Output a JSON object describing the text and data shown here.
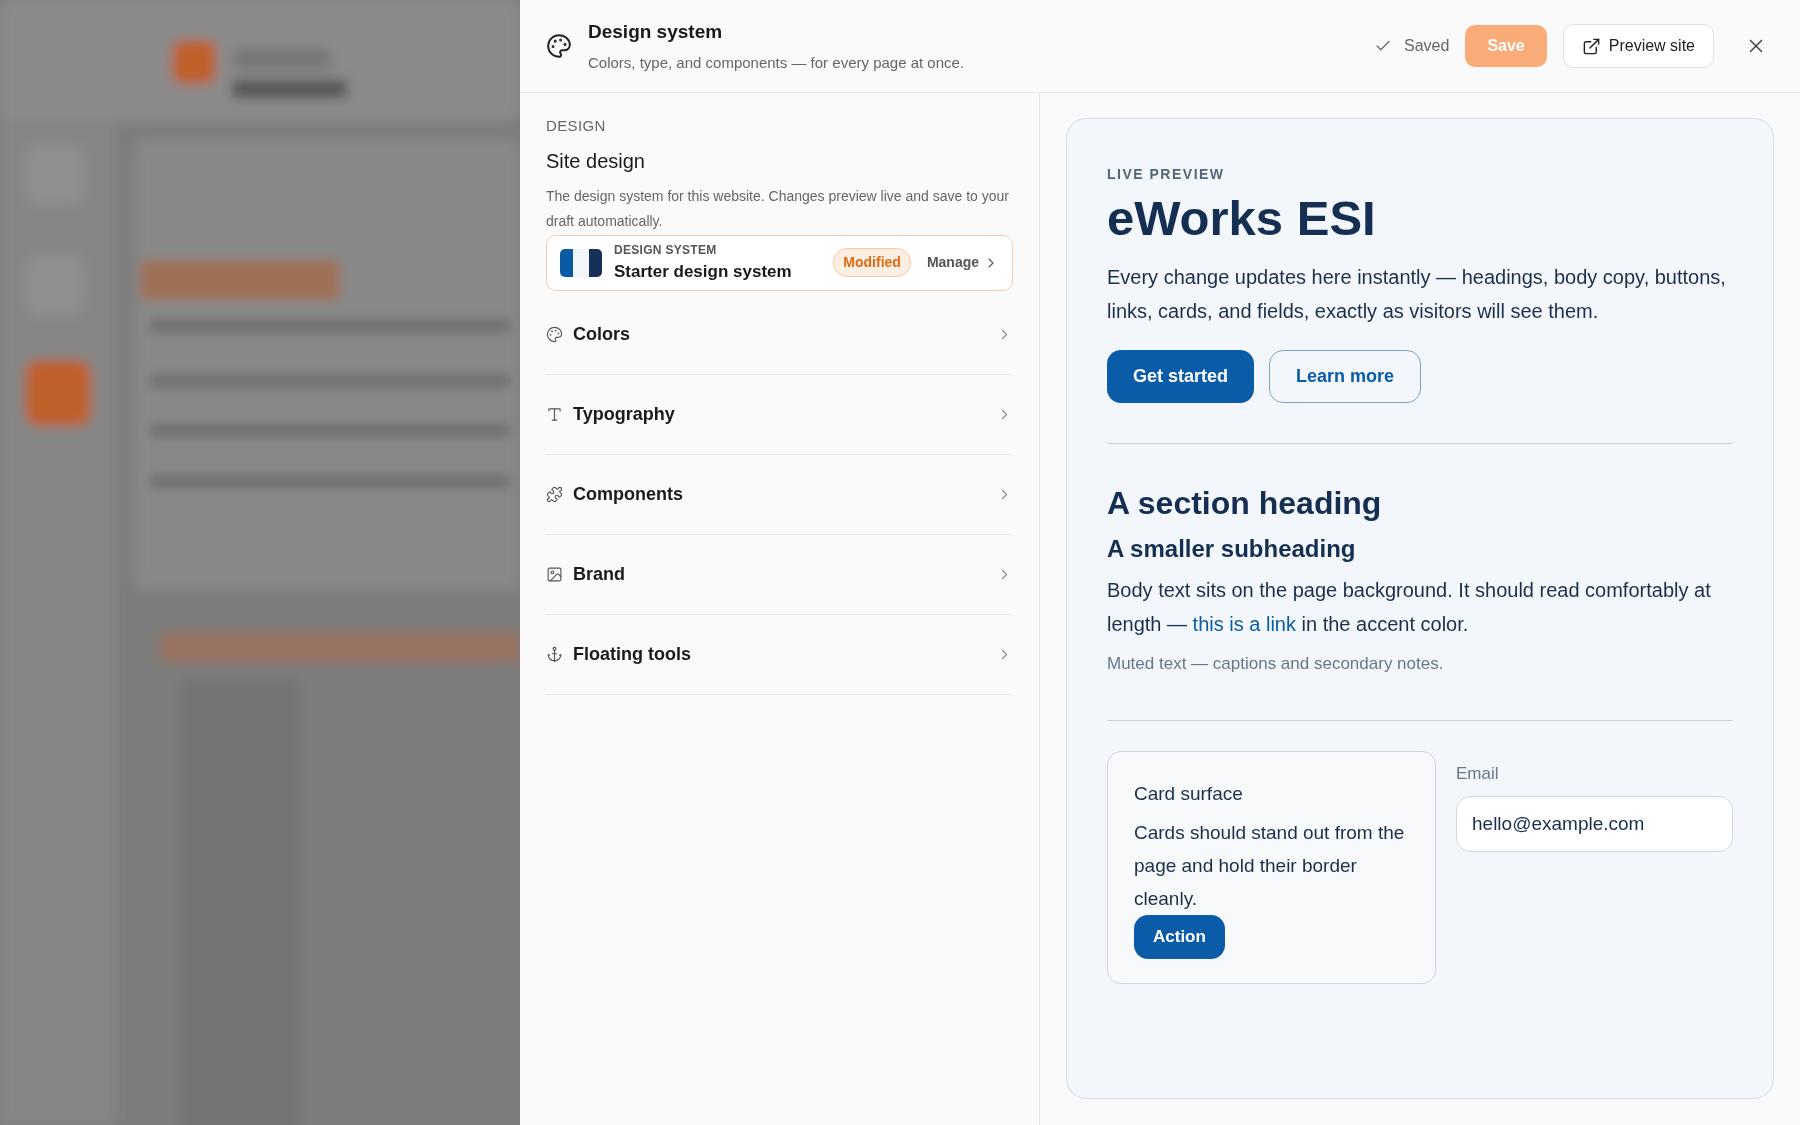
{
  "header": {
    "title": "Design system",
    "subtitle": "Colors, type, and components — for every page at once.",
    "status": "Saved",
    "save_button": {
      "label": "Save",
      "disabled": true
    },
    "preview_button": "Preview site"
  },
  "design": {
    "eyebrow": "DESIGN",
    "title": "Site design",
    "description": "The design system for this website. Changes preview live and save to your draft automatically.",
    "system": {
      "eyebrow": "DESIGN SYSTEM",
      "name": "Starter design system",
      "badge": "Modified",
      "action": "Manage"
    }
  },
  "sections": [
    {
      "label": "Colors"
    },
    {
      "label": "Typography"
    },
    {
      "label": "Components"
    },
    {
      "label": "Brand"
    },
    {
      "label": "Floating tools"
    }
  ],
  "preview": {
    "eyebrow": "LIVE PREVIEW",
    "title": "eWorks ESI",
    "intro": "Every change updates here instantly — headings, body copy, buttons, links, cards, and fields, exactly as visitors will see them.",
    "buttons": [
      {
        "label": "Get started",
        "kind": "primary"
      },
      {
        "label": "Learn more",
        "kind": "outline"
      }
    ],
    "heading": "A section heading",
    "subheading": "A smaller subheading",
    "body": {
      "before": "Body text sits on the page background. It should read comfortably at length — ",
      "link": "this is a link",
      "after": " in the accent color."
    },
    "muted": "Muted text — captions and secondary notes.",
    "card": {
      "title": "Card surface",
      "text": "Cards should stand out from the page and hold their border cleanly.",
      "button": "Action"
    },
    "field": {
      "label": "Email",
      "value": "hello@example.com"
    }
  }
}
